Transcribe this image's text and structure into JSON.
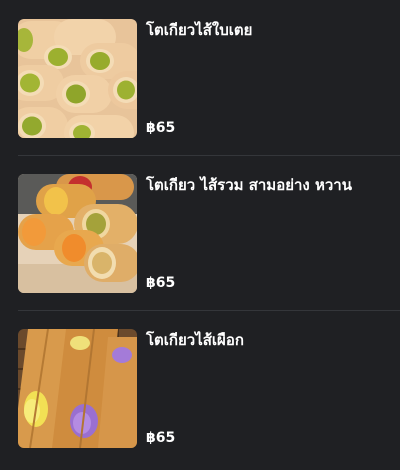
{
  "menu": {
    "items": [
      {
        "name": "โตเกียวไส้ใบเตย",
        "price": "฿65",
        "image": "pandan-custard-tokyo-crepe-photo"
      },
      {
        "name": "โตเกียว ไส้รวม สามอย่าง หวาน",
        "price": "฿65",
        "image": "mixed-sweet-tokyo-crepe-photo"
      },
      {
        "name": "โตเกียวไส้เผือก",
        "price": "฿65",
        "image": "taro-tokyo-crepe-photo"
      }
    ]
  },
  "colors": {
    "background": "#1f2023",
    "divider": "#34363a",
    "text": "#ffffff"
  }
}
